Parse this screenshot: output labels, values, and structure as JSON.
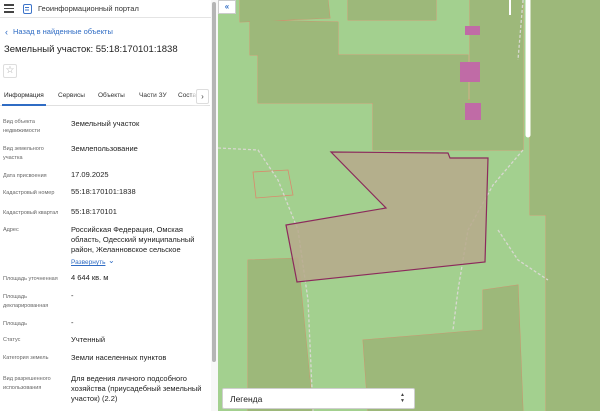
{
  "header": {
    "title": "Геоинформационный портал"
  },
  "nav": {
    "back_label": "Назад в найденные объекты"
  },
  "object": {
    "title": "Земельный участок: 55:18:170101:1838"
  },
  "tabs": [
    "Информация",
    "Сервисы",
    "Объекты",
    "Части ЗУ",
    "Соста"
  ],
  "properties": [
    {
      "label": "Вид объекта недвижимости",
      "value": "Земельный участок"
    },
    {
      "label": "Вид земельного участка",
      "value": "Землепользование"
    },
    {
      "label": "Дата присвоения",
      "value": "17.09.2025"
    },
    {
      "label": "Кадастровый номер",
      "value": "55:18:170101:1838"
    },
    {
      "label": "Кадастровый квартал",
      "value": "55:18:170101"
    },
    {
      "label": "Адрес",
      "value": "Российская Федерация, Омская область, Одесский муниципальный район, Желанновское сельское"
    },
    {
      "label": "Площадь уточненная",
      "value": "4 644 кв. м"
    },
    {
      "label": "Площадь декларированная",
      "value": "-"
    },
    {
      "label": "Площадь",
      "value": "-"
    },
    {
      "label": "Статус",
      "value": "Учтенный"
    },
    {
      "label": "Категория земель",
      "value": "Земли населенных пунктов"
    },
    {
      "label": "Вид разрешенного использования",
      "value": "Для ведения личного подсобного хозяйства (приусадебный земельный участок) (2.2)"
    }
  ],
  "expand_label": "Развернуть",
  "legend": {
    "label": "Легенда"
  },
  "colors": {
    "accent": "#2f6cc4",
    "map_green": "#a3d08f",
    "parcel_fill": "#b7a98c",
    "parcel_border": "#8c2a5c",
    "building": "#c06ba6"
  }
}
